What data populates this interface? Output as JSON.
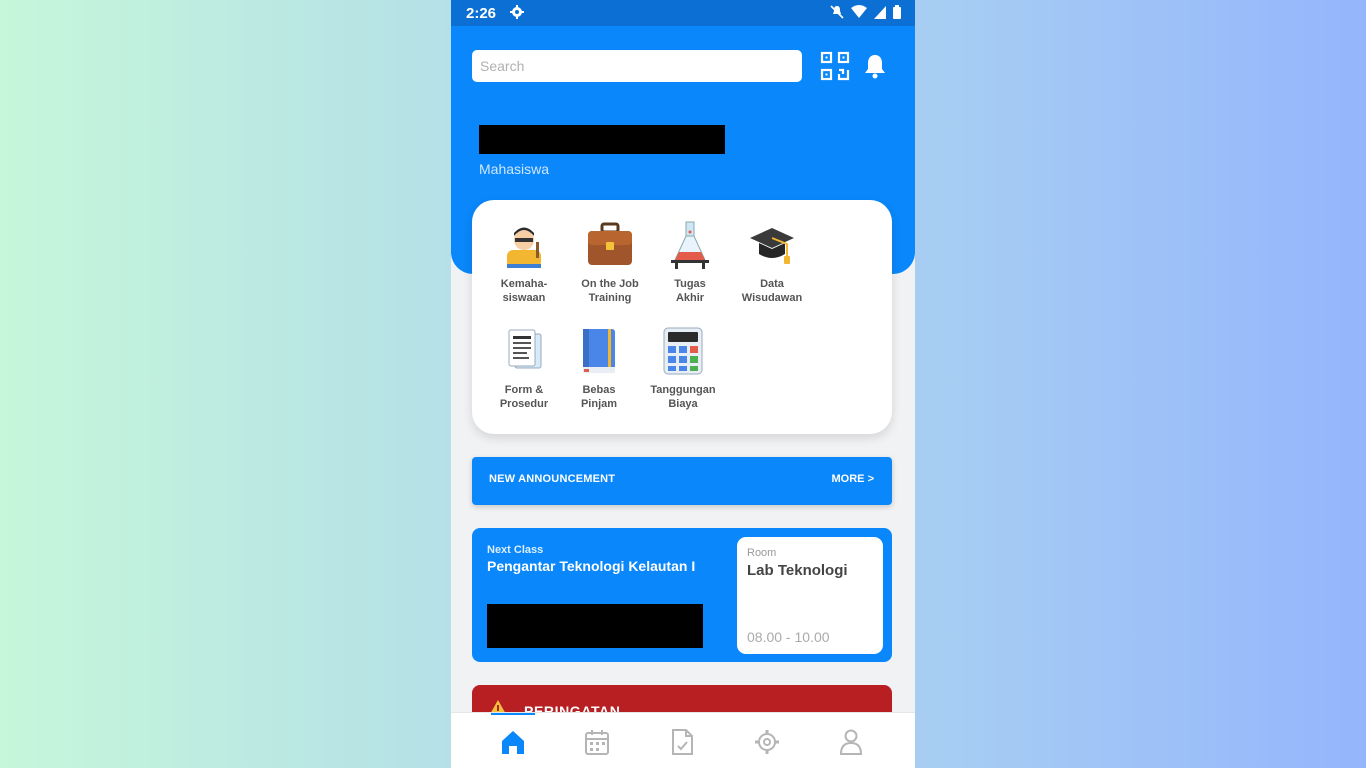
{
  "status_bar": {
    "time": "2:26",
    "icons": [
      "settings-icon",
      "mute-icon",
      "wifi-icon",
      "signal-icon",
      "battery-icon"
    ]
  },
  "header": {
    "search_placeholder": "Search",
    "qr_icon": "qr-code-scan-icon",
    "notification_icon": "bell-icon"
  },
  "profile": {
    "name": "",
    "role": "Mahasiswa"
  },
  "menu": {
    "items": [
      {
        "label_line1": "Kemaha-",
        "label_line2": "siswaan",
        "icon": "student-icon"
      },
      {
        "label_line1": "On the Job",
        "label_line2": "Training",
        "icon": "briefcase-icon"
      },
      {
        "label_line1": "Tugas",
        "label_line2": "Akhir",
        "icon": "flask-icon"
      },
      {
        "label_line1": "Data",
        "label_line2": "Wisudawan",
        "icon": "graduation-cap-icon"
      },
      {
        "label_line1": "Form &",
        "label_line2": "Prosedur",
        "icon": "documents-icon"
      },
      {
        "label_line1": "Bebas",
        "label_line2": "Pinjam",
        "icon": "book-icon"
      },
      {
        "label_line1": "Tanggungan",
        "label_line2": "Biaya",
        "icon": "calculator-icon"
      }
    ]
  },
  "announcement": {
    "title": "NEW ANNOUNCEMENT",
    "more": "MORE  >"
  },
  "next_class": {
    "label": "Next Class",
    "course": "Pengantar Teknologi Kelautan I",
    "room_label": "Room",
    "room_name": "Lab Teknologi",
    "time": "08.00 - 10.00"
  },
  "warning": {
    "title": "PERINGATAN",
    "icon": "warning-icon"
  },
  "bottom_nav": {
    "items": [
      "home-icon",
      "calendar-icon",
      "document-icon",
      "settings-cog-icon",
      "profile-icon"
    ],
    "active": "home-icon"
  },
  "colors": {
    "primary": "#0a87fb",
    "status_bar": "#0b6fd3",
    "warning": "#b81f23"
  }
}
